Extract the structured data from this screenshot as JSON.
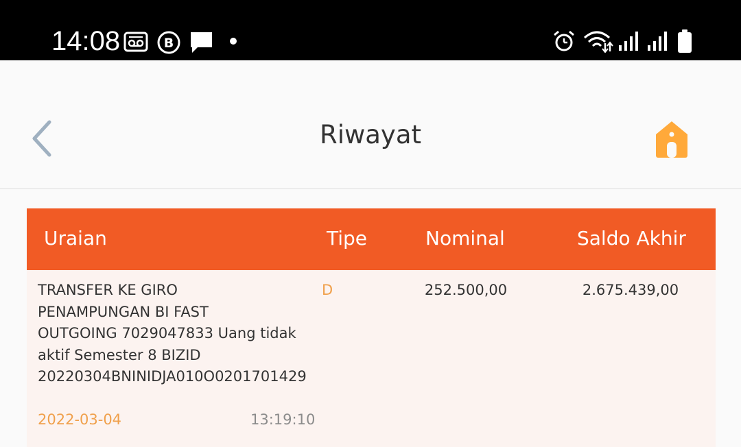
{
  "status_bar": {
    "time": "14:08",
    "left_icons": [
      "voicemail-icon",
      "b-circle-icon",
      "message-icon",
      "dot-icon"
    ],
    "right_icons": [
      "alarm-icon",
      "wifi-icon",
      "signal-icon",
      "signal-icon",
      "battery-icon"
    ]
  },
  "header": {
    "title": "Riwayat",
    "back_icon": "chevron-left-icon",
    "home_icon": "home-icon"
  },
  "table": {
    "columns": [
      "Uraian",
      "Tipe",
      "Nominal",
      "Saldo Akhir"
    ],
    "rows": [
      {
        "uraian": "TRANSFER KE GIRO\nPENAMPUNGAN BI FAST\nOUTGOING 7029047833 Uang tidak\naktif Semester 8 BIZID\n20220304BNINIDJA010O0201701429",
        "tipe": "D",
        "nominal": "252.500,00",
        "saldo_akhir": "2.675.439,00",
        "date": "2022-03-04",
        "time": "13:19:10"
      }
    ]
  },
  "colors": {
    "header_bg": "#f15b25",
    "row_bg": "#fcf3f0",
    "accent_orange": "#f0a04b",
    "home_icon": "#ffa93a",
    "back_icon": "#9fb0c0"
  }
}
